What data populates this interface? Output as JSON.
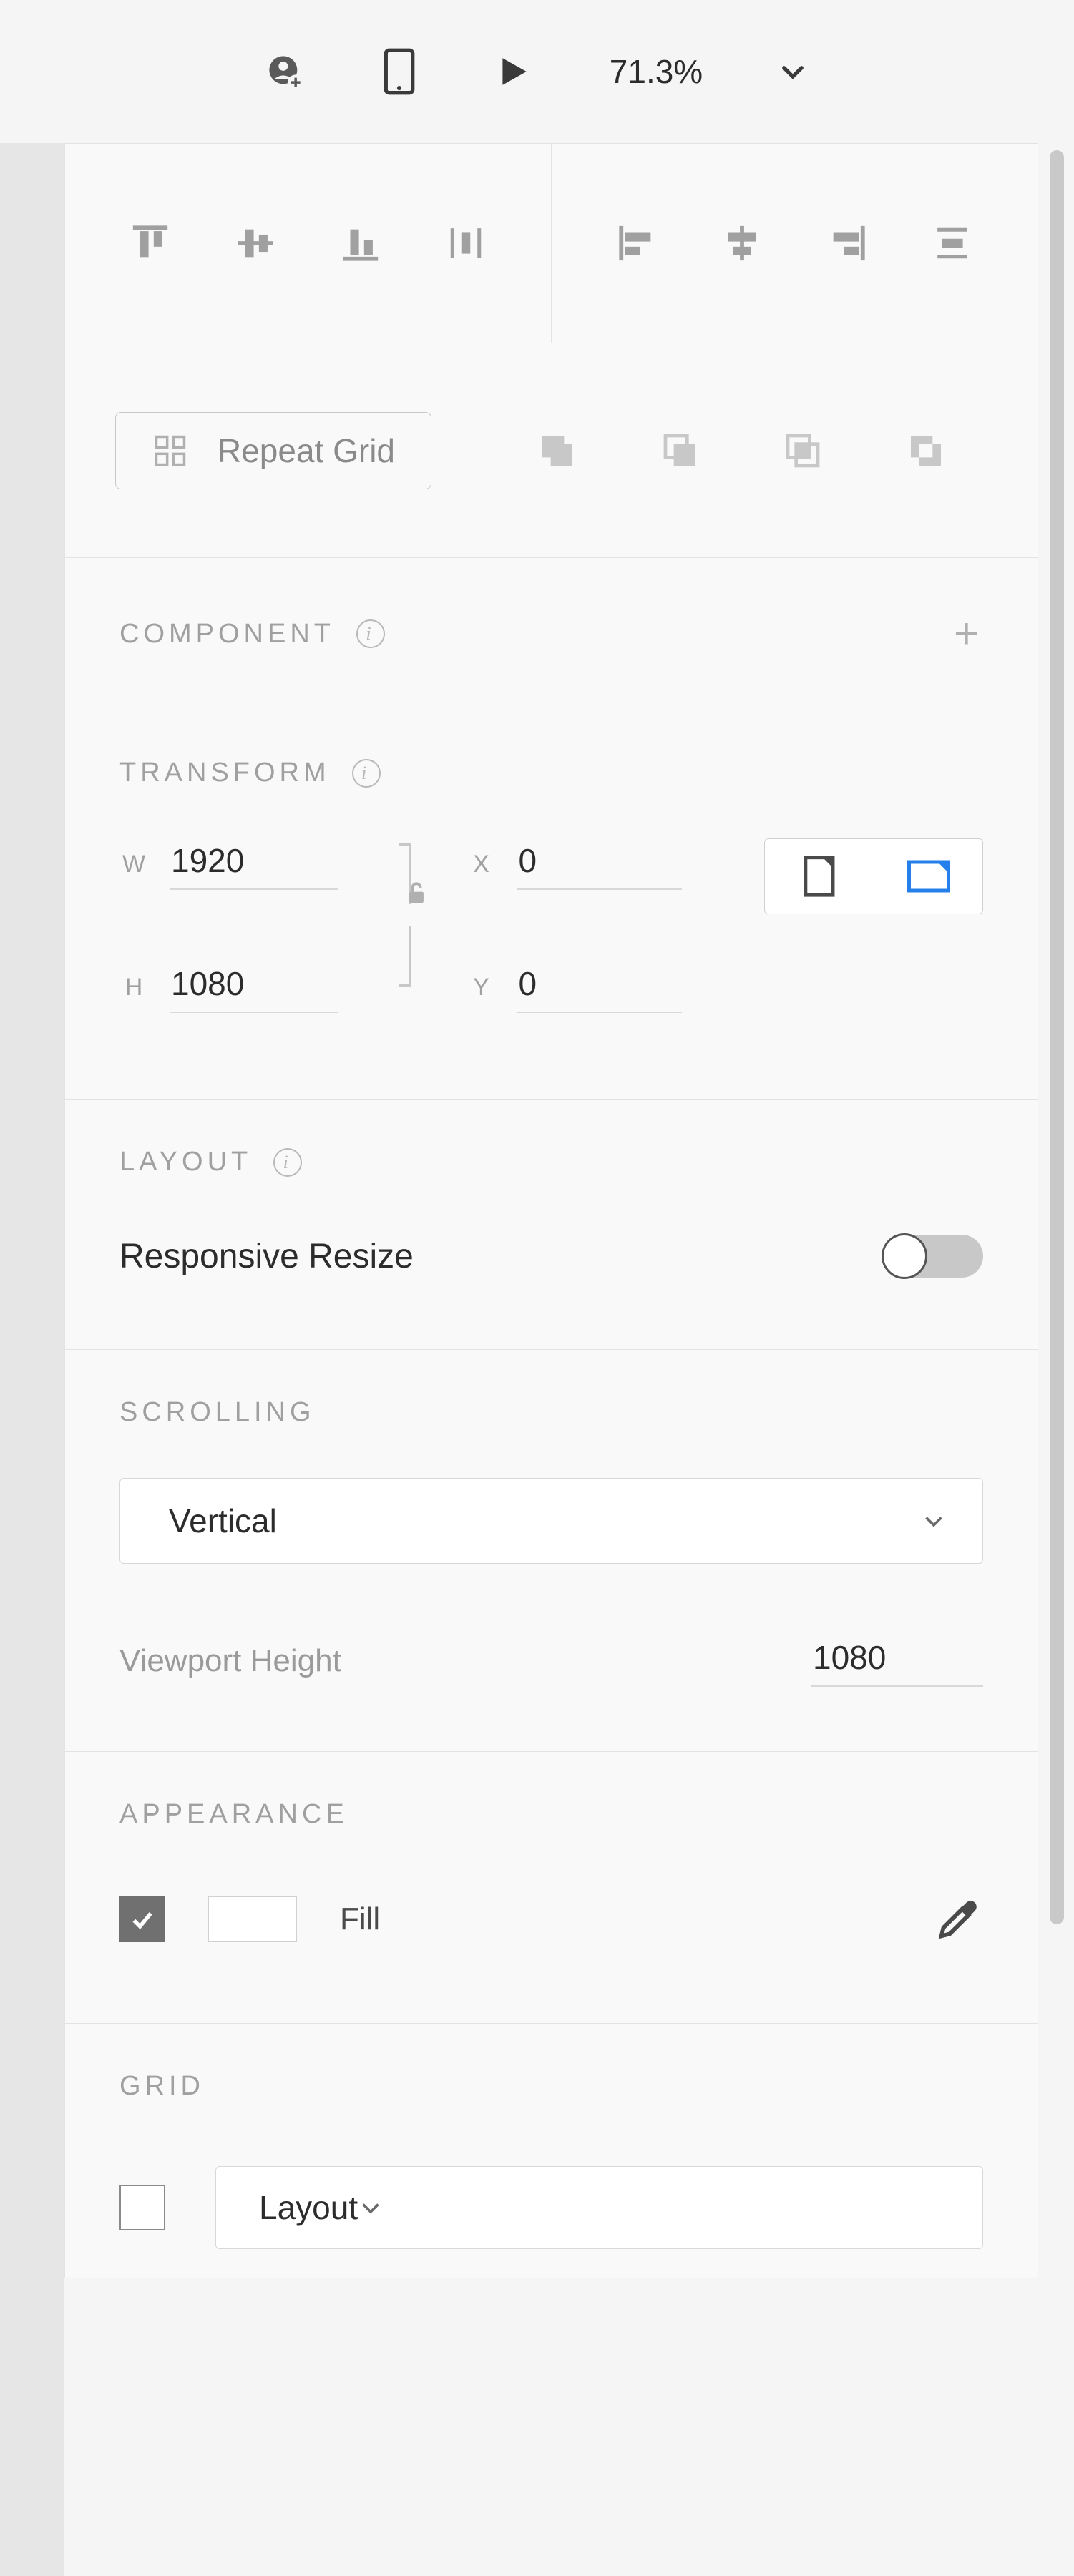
{
  "topbar": {
    "zoom": "71.3%"
  },
  "repeat": {
    "button_label": "Repeat Grid"
  },
  "sections": {
    "component": "COMPONENT",
    "transform": "TRANSFORM",
    "layout": "LAYOUT",
    "scrolling": "SCROLLING",
    "appearance": "APPEARANCE",
    "grid": "GRID"
  },
  "transform": {
    "w_label": "W",
    "h_label": "H",
    "x_label": "X",
    "y_label": "Y",
    "w": "1920",
    "h": "1080",
    "x": "0",
    "y": "0"
  },
  "layout": {
    "responsive_label": "Responsive Resize",
    "responsive_on": false
  },
  "scrolling": {
    "mode": "Vertical",
    "viewport_label": "Viewport Height",
    "viewport_height": "1080"
  },
  "appearance": {
    "fill_enabled": true,
    "fill_label": "Fill",
    "fill_color": "#FFFFFF"
  },
  "grid": {
    "enabled": false,
    "type": "Layout"
  }
}
